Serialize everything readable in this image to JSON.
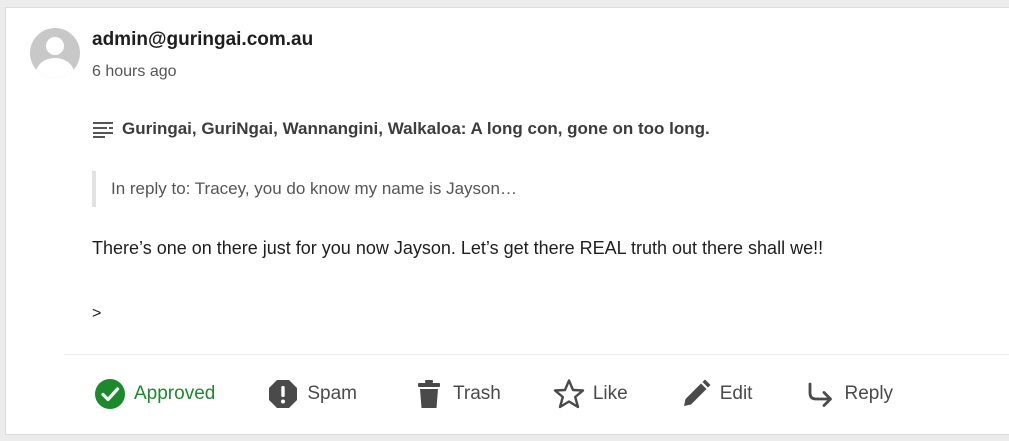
{
  "comment": {
    "author": "admin@guringai.com.au",
    "timestamp": "6 hours ago",
    "post_title": "Guringai, GuriNgai, Wannangini, Walkaloa: A long con, gone on too long.",
    "reply_to": "In reply to: Tracey, you do know my name is Jayson…",
    "body": "There’s one on there just for you now Jayson. Let’s get there REAL truth out there shall we!!",
    "body_extra": ">"
  },
  "actions": {
    "approved_label": "Approved",
    "spam_label": "Spam",
    "trash_label": "Trash",
    "like_label": "Like",
    "edit_label": "Edit",
    "reply_label": "Reply"
  },
  "icons": {
    "avatar": "default-avatar-icon",
    "post": "post-lines-icon",
    "approved": "check-circle-icon",
    "spam": "alert-octagon-icon",
    "trash": "trash-icon",
    "like": "star-outline-icon",
    "edit": "pencil-icon",
    "reply": "reply-arrow-icon"
  },
  "colors": {
    "approved": "#1a8a2b",
    "action_icon": "#4a4a4a",
    "background": "#ececec",
    "card": "#ffffff"
  }
}
